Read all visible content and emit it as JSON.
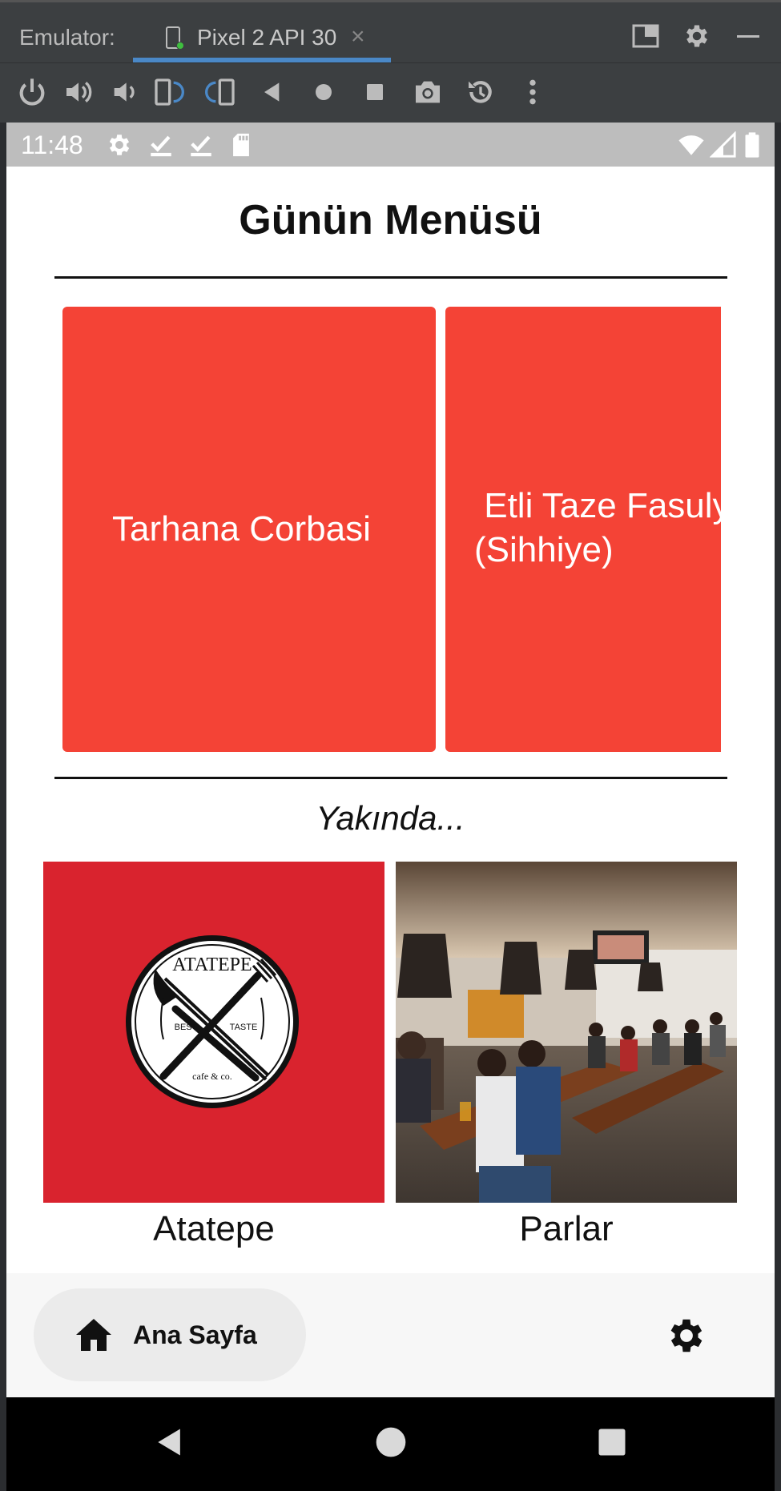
{
  "emulator": {
    "label": "Emulator:",
    "tab_title": "Pixel 2 API 30",
    "tab_close": "×",
    "accent": "#4a88c7"
  },
  "toolbar": {
    "icons": [
      "power-icon",
      "volume-up-icon",
      "volume-down-icon",
      "rotate-left-icon",
      "rotate-right-icon",
      "back-icon",
      "home-icon",
      "overview-icon",
      "camera-icon",
      "snapshot-icon",
      "more-icon"
    ]
  },
  "status_bar": {
    "time": "11:48",
    "icons": [
      "settings-icon",
      "check-icon",
      "check-icon",
      "sd-card-icon",
      "wifi-icon",
      "signal-icon",
      "battery-icon"
    ]
  },
  "page": {
    "title": "Günün Menüsü",
    "menu_items": [
      {
        "line1": "Tarhana Corbasi",
        "line2": ""
      },
      {
        "line1": " Etli Taze Fasulye",
        "line2": "(Sihhiye)"
      }
    ],
    "card_color": "#f44336",
    "soon_label": "Yakında...",
    "places": [
      {
        "name": "Atatepe",
        "logo_text_top": "ATATEPE",
        "logo_left": "BEST",
        "logo_right": "TASTE",
        "logo_bottom": "cafe & co.",
        "bg": "#d9232e"
      },
      {
        "name": "Parlar"
      }
    ]
  },
  "bottom_nav": {
    "home_label": "Ana Sayfa"
  }
}
